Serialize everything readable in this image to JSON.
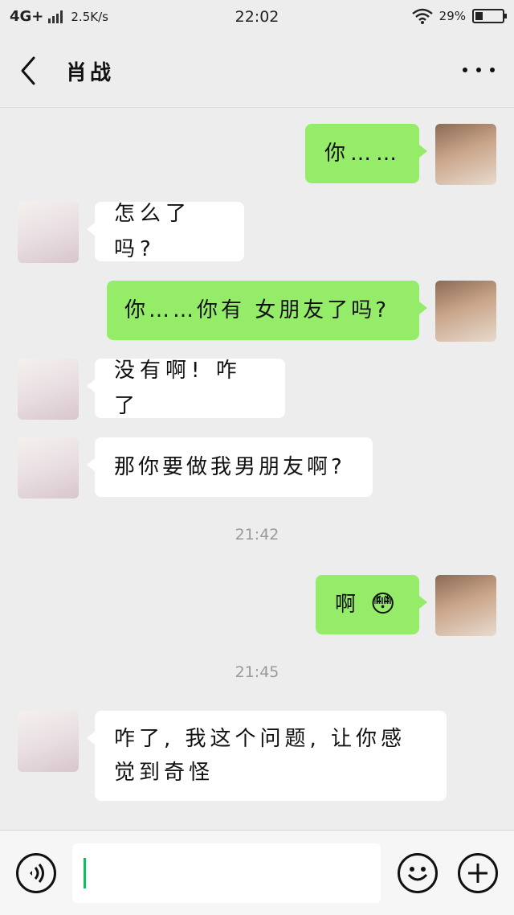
{
  "status_bar": {
    "network": "4G+",
    "speed": "2.5K/s",
    "time": "22:02",
    "battery_text": "29%",
    "battery_level": 0.29
  },
  "header": {
    "title": "肖战"
  },
  "messages": [
    {
      "side": "self",
      "text": "你……"
    },
    {
      "side": "other",
      "text": "怎么了吗?"
    },
    {
      "side": "self",
      "text": "你……你有 女朋友了吗?"
    },
    {
      "side": "other",
      "text": "没有啊! 咋了"
    },
    {
      "side": "other",
      "text": "那你要做我男朋友啊?"
    },
    {
      "side": "self",
      "text": "啊",
      "emoji": "😳"
    },
    {
      "side": "other",
      "text_line1": "咋了, 我这个问题, 让你感",
      "text_line2": "觉到奇怪"
    }
  ],
  "timestamps": [
    "21:42",
    "21:45"
  ],
  "input": {
    "value": "",
    "voice_icon": "voice-icon",
    "emoji_icon": "emoji-icon",
    "plus_icon": "plus-icon"
  },
  "colors": {
    "self_bubble": "#95ec69",
    "other_bubble": "#ffffff",
    "background": "#ededed",
    "caret": "#07c160"
  }
}
